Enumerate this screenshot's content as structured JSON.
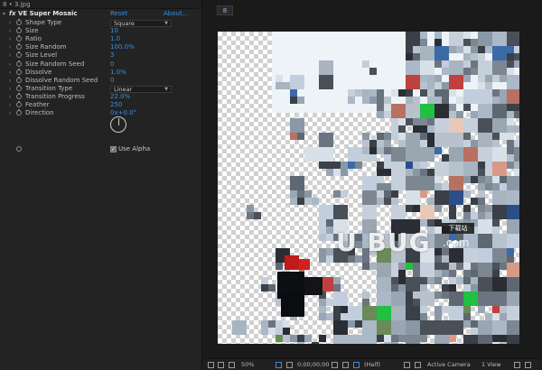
{
  "panel": {
    "tab_title": "8 • 3.jpg",
    "effect": {
      "fx": "fx",
      "name": "VE Super Mosaic",
      "reset": "Reset",
      "about": "About..."
    },
    "params": [
      {
        "label": "Shape Type",
        "type": "dropdown",
        "value": "Square"
      },
      {
        "label": "Size",
        "type": "value",
        "value": "10"
      },
      {
        "label": "Ratio",
        "type": "value",
        "value": "1.0"
      },
      {
        "label": "Size Random",
        "type": "value",
        "value": "100.0%"
      },
      {
        "label": "Size Level",
        "type": "value",
        "value": "3"
      },
      {
        "label": "Size Random Seed",
        "type": "value",
        "value": "0"
      },
      {
        "label": "Dissolve",
        "type": "value",
        "value": "1.0%"
      },
      {
        "label": "Dissolve Random Seed",
        "type": "value",
        "value": "0"
      },
      {
        "label": "Transition Type",
        "type": "dropdown",
        "value": "Linear"
      },
      {
        "label": "Transition Progress",
        "type": "value",
        "value": "22.0%"
      },
      {
        "label": "Feather",
        "type": "value",
        "value": "250"
      },
      {
        "label": "Direction",
        "type": "value",
        "value": "0x+0.0°"
      }
    ],
    "use_alpha": {
      "label": "Use Alpha",
      "checked": true
    }
  },
  "comp": {
    "tab_label": "8",
    "watermark": {
      "main": "U BUG",
      "com": ".com",
      "cn": "下载站"
    },
    "toolbar": {
      "zoom": "50%",
      "timecode": "0;00;00;00",
      "resolution": "(Half)",
      "camera": "Active Camera",
      "view": "1 View"
    }
  },
  "colors": {
    "accent": "#3a8fdd",
    "panel_bg": "#232323",
    "comp_bg": "#1a1a1a"
  }
}
